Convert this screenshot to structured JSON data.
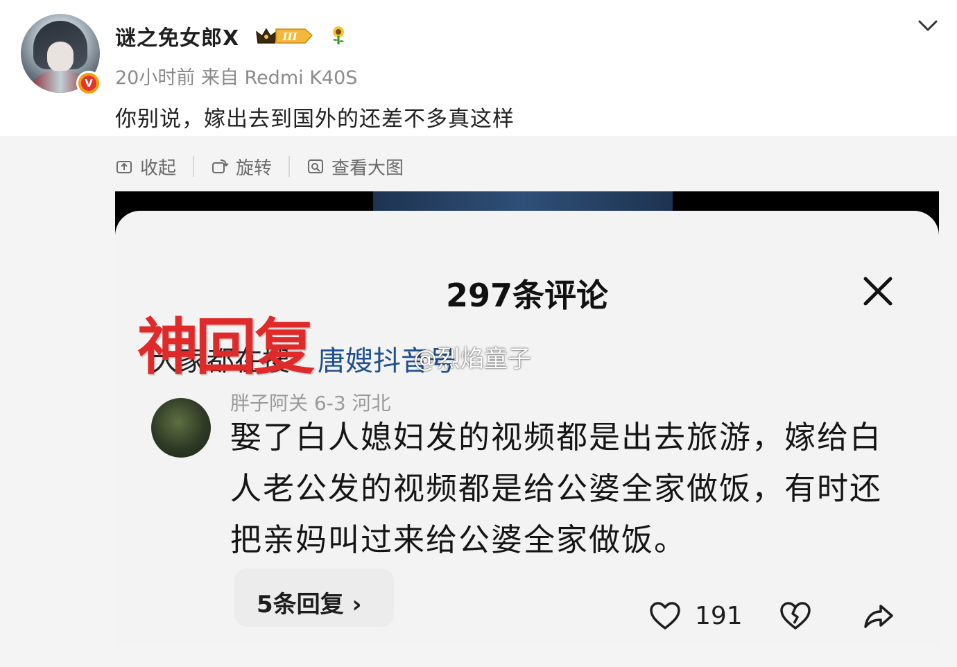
{
  "post": {
    "username": "谜之免女郎X",
    "time_source": "20小时前  来自 Redmi K40S",
    "text": "你别说，嫁出去到国外的还差不多真这样",
    "level_badge": "III",
    "verified_badge": "V"
  },
  "toolbar": {
    "collapse_label": "收起",
    "rotate_label": "旋转",
    "view_large_label": "查看大图"
  },
  "screenshot": {
    "title": "297条评论",
    "overlay_caption": "神回复",
    "search_prefix": "大家都在搜：",
    "search_link": "唐嫂抖音号",
    "watermark": "@烈焰童子",
    "comment_meta": "胖子阿关  6-3  河北",
    "comment_text": "娶了白人媳妇发的视频都是出去旅游，嫁给白人老公发的视频都是给公婆全家做饭，有时还把亲妈叫过来给公婆全家做饭。",
    "replies_label": "5条回复 ›",
    "like_count": "191"
  },
  "icons": {
    "collapse": "collapse-icon",
    "rotate": "rotate-icon",
    "view_large": "view-large-icon",
    "close": "close-icon",
    "like": "heart-icon",
    "dislike": "broken-heart-icon",
    "share": "share-icon",
    "more": "chevron-down-icon"
  },
  "colors": {
    "accent_red": "#e02a2a",
    "link_blue": "#1f4f8f",
    "meta_gray": "#8a8a8a"
  }
}
